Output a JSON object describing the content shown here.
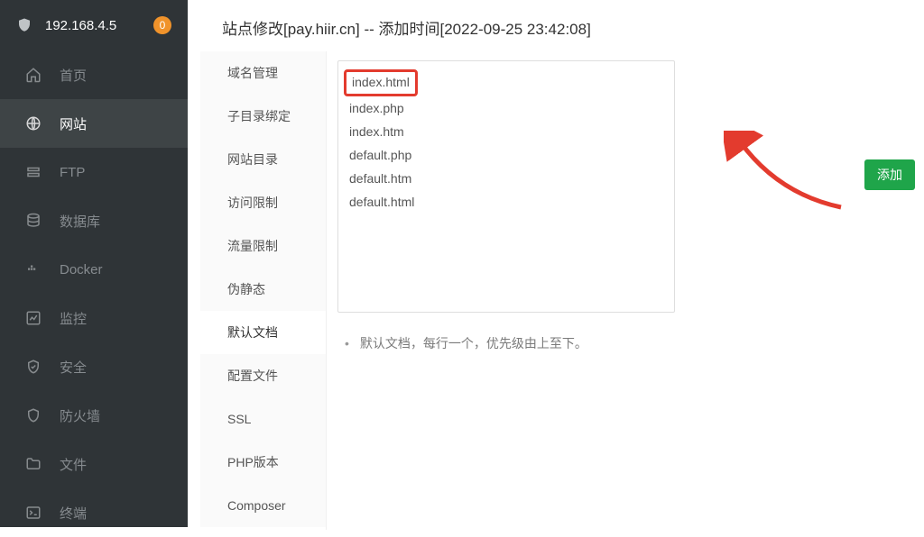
{
  "header": {
    "ip": "192.168.4.5",
    "badge": "0"
  },
  "sidebar": {
    "items": [
      {
        "label": "首页"
      },
      {
        "label": "网站"
      },
      {
        "label": "FTP"
      },
      {
        "label": "数据库"
      },
      {
        "label": "Docker"
      },
      {
        "label": "监控"
      },
      {
        "label": "安全"
      },
      {
        "label": "防火墙"
      },
      {
        "label": "文件"
      },
      {
        "label": "终端"
      }
    ]
  },
  "panel": {
    "title": "站点修改[pay.hiir.cn] -- 添加时间[2022-09-25 23:42:08]",
    "tabs": [
      {
        "label": "域名管理"
      },
      {
        "label": "子目录绑定"
      },
      {
        "label": "网站目录"
      },
      {
        "label": "访问限制"
      },
      {
        "label": "流量限制"
      },
      {
        "label": "伪静态"
      },
      {
        "label": "默认文档"
      },
      {
        "label": "配置文件"
      },
      {
        "label": "SSL"
      },
      {
        "label": "PHP版本"
      },
      {
        "label": "Composer"
      }
    ],
    "default_docs": [
      "index.html",
      "index.php",
      "index.htm",
      "default.php",
      "default.htm",
      "default.html"
    ],
    "hint": "默认文档，每行一个，优先级由上至下。",
    "add_label": "添加"
  }
}
